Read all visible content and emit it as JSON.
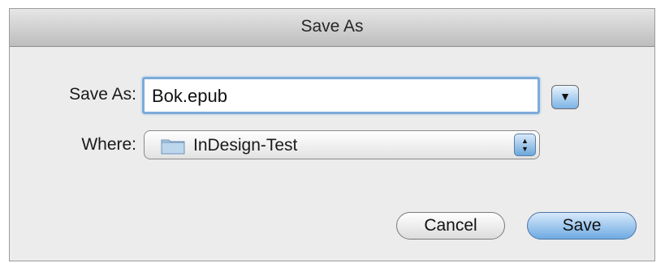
{
  "window": {
    "title": "Save As"
  },
  "form": {
    "save_as_label": "Save As:",
    "save_as_value": "Bok.epub",
    "where_label": "Where:",
    "where_value": "InDesign-Test"
  },
  "buttons": {
    "cancel_label": "Cancel",
    "save_label": "Save"
  },
  "icons": {
    "expand": "chevron-down-icon",
    "folder": "folder-icon",
    "stepper": "up-down-arrows-icon"
  },
  "colors": {
    "accent": "#7bb3e6",
    "focus_ring": "#7cabd8",
    "dialog_bg": "#ececec"
  }
}
